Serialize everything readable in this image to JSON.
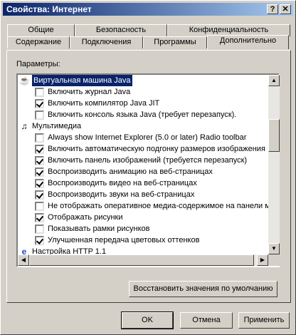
{
  "window": {
    "title": "Свойства: Интернет"
  },
  "titlebar": {
    "help": "?",
    "close": "✕"
  },
  "tabs_back": [
    "Общие",
    "Безопасность",
    "Конфиденциальность"
  ],
  "tabs_front": [
    "Содержание",
    "Подключения",
    "Программы",
    "Дополнительно"
  ],
  "params_label": "Параметры:",
  "list": [
    {
      "kind": "category",
      "label": "Виртуальная машина Java",
      "selected": true,
      "icon": "java-icon"
    },
    {
      "kind": "check",
      "label": "Включить журнал Java",
      "checked": false
    },
    {
      "kind": "check",
      "label": "Включить компилятор Java JIT",
      "checked": true
    },
    {
      "kind": "check",
      "label": "Включить консоль языка Java (требует перезапуск).",
      "checked": false
    },
    {
      "kind": "category",
      "label": "Мультимедиа",
      "icon": "multimedia-icon"
    },
    {
      "kind": "check",
      "label": "Always show Internet Explorer (5.0 or later) Radio toolbar",
      "checked": false
    },
    {
      "kind": "check",
      "label": "Включить автоматическую подгонку размеров изображения",
      "checked": true
    },
    {
      "kind": "check",
      "label": "Включить панель изображений (требуется перезапуск)",
      "checked": true
    },
    {
      "kind": "check",
      "label": "Воспроизводить анимацию на веб-страницах",
      "checked": true
    },
    {
      "kind": "check",
      "label": "Воспроизводить видео на веб-страницах",
      "checked": true
    },
    {
      "kind": "check",
      "label": "Воспроизводить звуки на веб-страницах",
      "checked": true
    },
    {
      "kind": "check",
      "label": "Не отображать оперативное медиа-содержимое на панели м",
      "checked": false
    },
    {
      "kind": "check",
      "label": "Отображать рисунки",
      "checked": true
    },
    {
      "kind": "check",
      "label": "Показывать рамки рисунков",
      "checked": false
    },
    {
      "kind": "check",
      "label": "Улучшенная передача цветовых оттенков",
      "checked": true
    },
    {
      "kind": "category",
      "label": "Настройка HTTP 1.1",
      "icon": "ie-icon"
    }
  ],
  "restore_button": "Восстановить значения по умолчанию",
  "buttons": {
    "ok": "OK",
    "cancel": "Отмена",
    "apply": "Применить"
  }
}
